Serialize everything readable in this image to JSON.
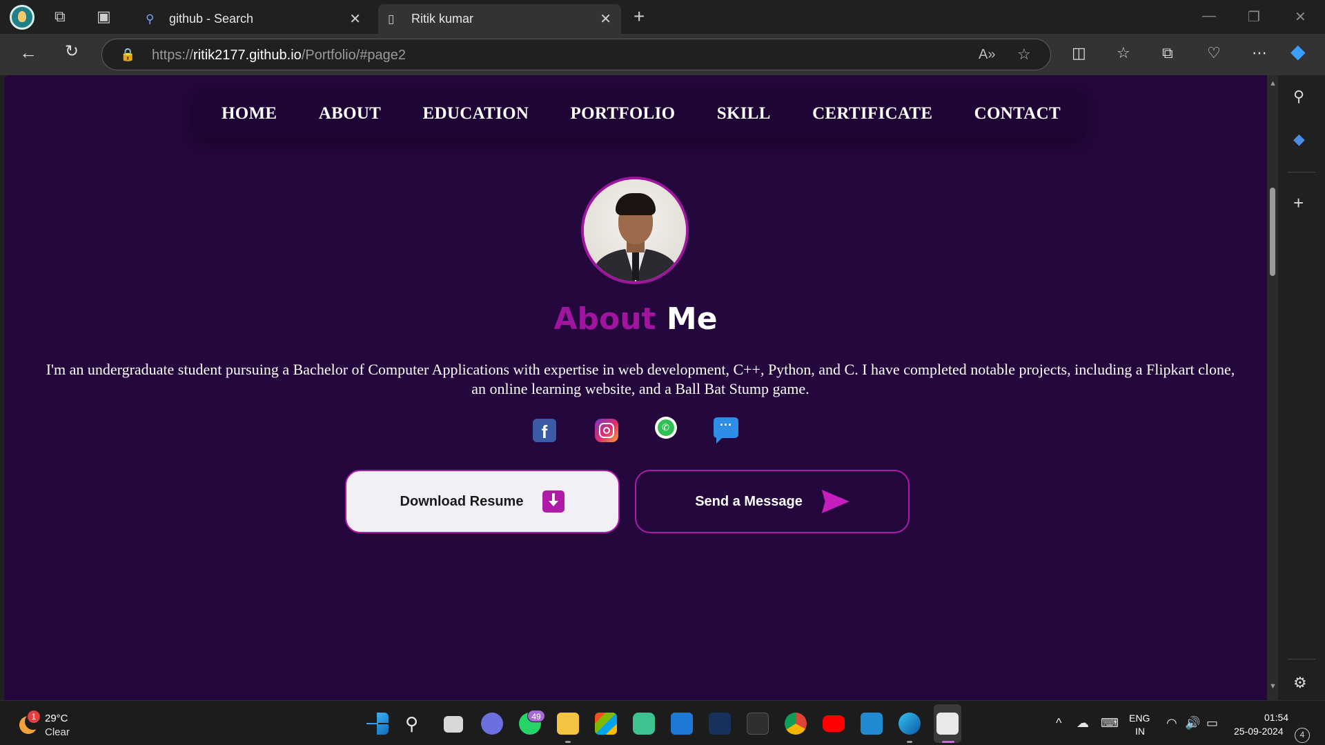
{
  "browser": {
    "tabs": [
      {
        "title": "github - Search",
        "active": false
      },
      {
        "title": "Ritik kumar",
        "active": true
      }
    ],
    "url": {
      "scheme": "https://",
      "host": "ritik2177.github.io",
      "path": "/Portfolio/#page2"
    }
  },
  "page": {
    "nav": {
      "items": [
        "HOME",
        "ABOUT",
        "EDUCATION",
        "PORTFOLIO",
        "SKILL",
        "CERTIFICATE",
        "CONTACT"
      ]
    },
    "about": {
      "title_accent": "About",
      "title_rest": "Me",
      "text": "I'm an undergraduate student pursuing a Bachelor of Computer Applications with expertise in web development, C++, Python, and C. I have completed notable projects, including a Flipkart clone, an online learning website, and a Ball Bat Stump game."
    },
    "social": [
      "facebook",
      "instagram",
      "whatsapp",
      "message"
    ],
    "buttons": {
      "resume": "Download Resume",
      "message": "Send a Message"
    },
    "colors": {
      "background": "#24073d",
      "accent": "#a0159e"
    }
  },
  "taskbar": {
    "weather": {
      "temp": "29°C",
      "condition": "Clear",
      "badge": "1"
    },
    "whatsapp_badge": "49",
    "language": {
      "line1": "ENG",
      "line2": "IN"
    },
    "clock": {
      "time": "01:54",
      "date": "25-09-2024"
    },
    "notifications": "4"
  }
}
